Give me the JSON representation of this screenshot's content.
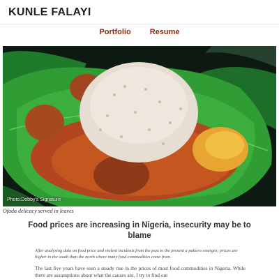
{
  "site": {
    "title": "KUNLE FALAYI"
  },
  "nav": {
    "items": [
      {
        "label": "Portfolio"
      },
      {
        "label": "Resume"
      }
    ]
  },
  "hero": {
    "photo_credit": "Photo:Dobby's Signature",
    "caption": "Ofada delicacy served in leaves"
  },
  "article": {
    "headline": "Food prices are increasing in Nigeria, insecurity may be to blame",
    "intro": "After analysing data on food price and violent incidents from the past to the present a pattern emerges; prices are higher in the south than the north where many food commodities come from.",
    "body": "The last five years have seen a steady rise in the prices of most food commodities in Nigeria. While there are assumptions about what the causes are, I try to find out"
  },
  "colors": {
    "nav_link": "#8b2b16",
    "header_rule": "#e6e6e6"
  }
}
